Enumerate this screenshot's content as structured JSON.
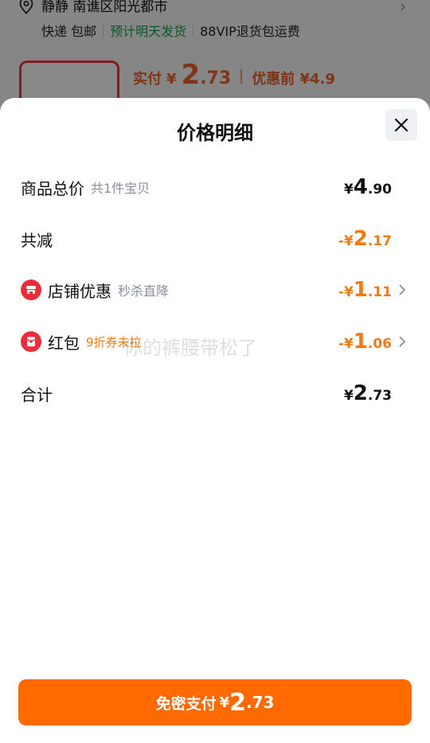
{
  "background": {
    "address": "静静 南谯区阳光都市",
    "shipping": {
      "method": "快递 包邮",
      "eta": "预计明天发货",
      "vip": "88VIP退货包运费"
    },
    "price": {
      "label": "实付",
      "yen": "¥",
      "int": "2",
      "dec": ".73",
      "before": "优惠前 ¥4.9"
    }
  },
  "sheet": {
    "title": "价格明细",
    "rows": [
      {
        "label": "商品总价",
        "sub": "共1件宝贝",
        "yen": "¥",
        "int": "4",
        "dec": ".90"
      },
      {
        "label": "共减",
        "sub": "",
        "yen": "-¥",
        "int": "2",
        "dec": ".17"
      },
      {
        "label": "店铺优惠",
        "sub": "秒杀直降",
        "yen": "-¥",
        "int": "1",
        "dec": ".11"
      },
      {
        "label": "红包",
        "sub": "9折券未拉",
        "yen": "-¥",
        "int": "1",
        "dec": ".06"
      },
      {
        "label": "合计",
        "sub": "",
        "yen": "¥",
        "int": "2",
        "dec": ".73"
      }
    ],
    "watermark": "你的裤腰带松了",
    "pay_button": {
      "label": "免密支付",
      "yen": "¥",
      "int": "2",
      "dec": ".73"
    }
  },
  "colors": {
    "accent_orange": "#f07b14",
    "pay_button": "#ff6a00",
    "icon_red": "#ee2d3c",
    "shipping_green": "#1a9b4b"
  },
  "icons": {
    "location": "location-pin-icon",
    "close": "close-icon",
    "store": "store-icon",
    "red_packet": "red-packet-icon",
    "chevron": "chevron-right-icon"
  }
}
